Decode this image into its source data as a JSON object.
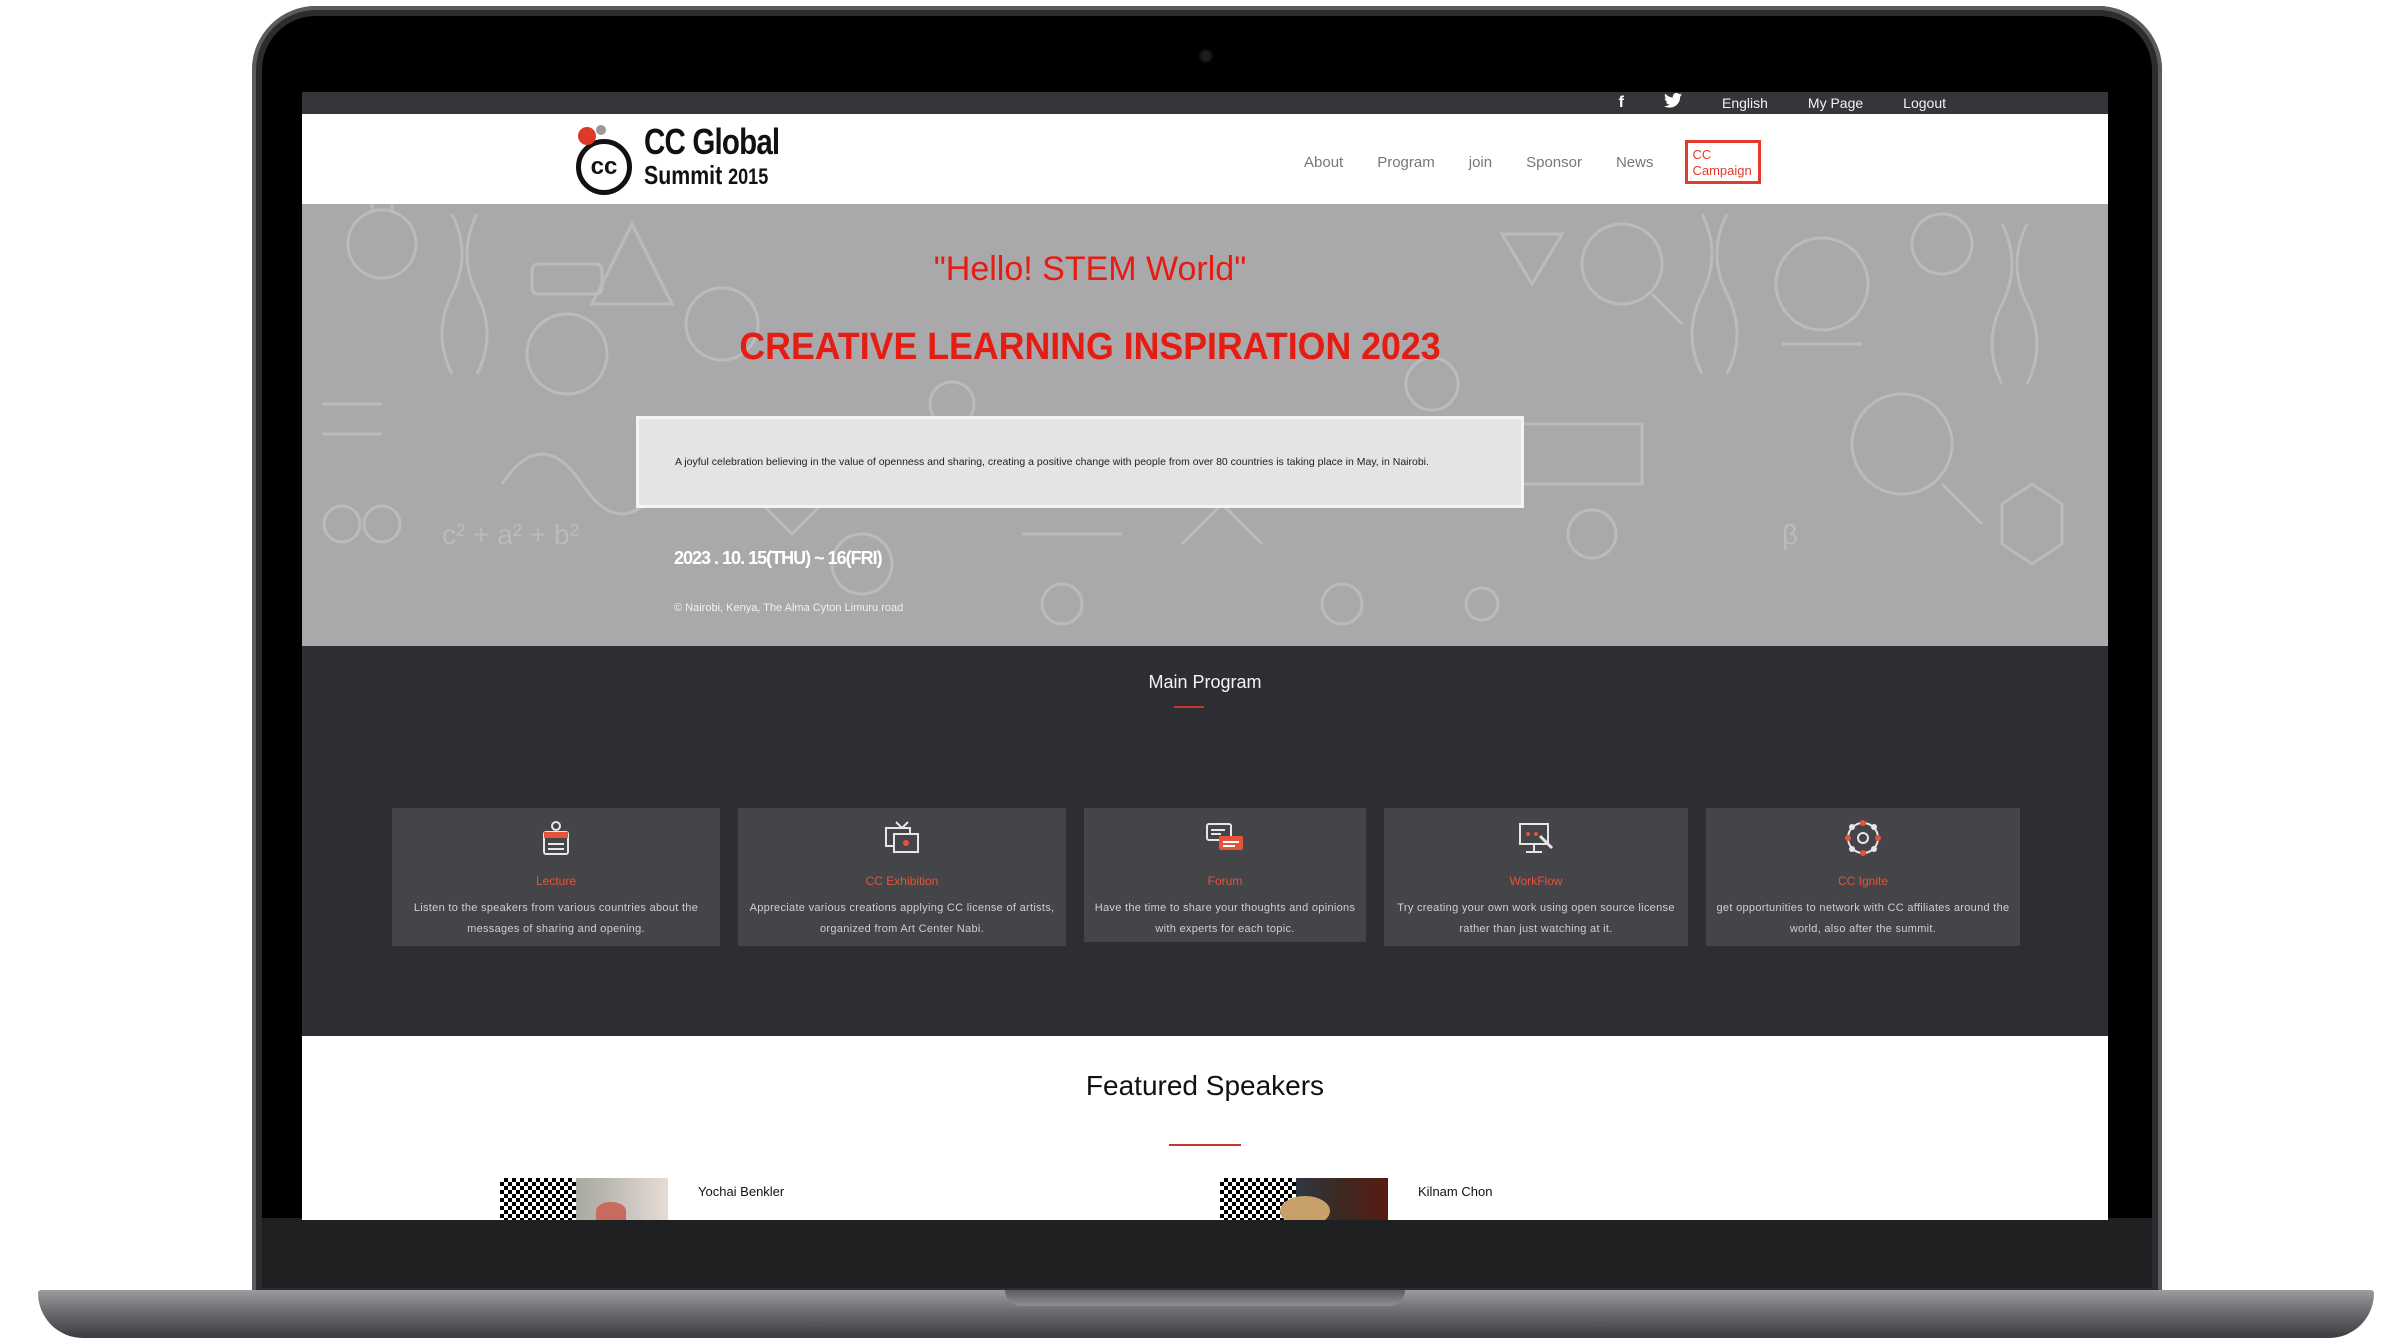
{
  "topbar": {
    "facebook_icon": "f",
    "twitter_icon": "twitter-bird",
    "language": "English",
    "my_page": "My Page",
    "logout": "Logout"
  },
  "logo": {
    "mark": "cc",
    "line1": "CC Global",
    "line2": "Summit",
    "year": "2015"
  },
  "nav": {
    "items": [
      "About",
      "Program",
      "join",
      "Sponsor",
      "News"
    ],
    "campaign": "CC Campaign"
  },
  "hero": {
    "quote": "\"Hello! STEM World\"",
    "headline": "CREATIVE LEARNING INSPIRATION 2023",
    "description": "A joyful celebration believing in the value of openness and sharing, creating a positive change with people from over 80 countries is taking place in May, in Nairobi.",
    "date": "2023 . 10. 15(THU) ~ 16(FRI)",
    "place": "© Nairobi, Kenya, The Alma Cyton Limuru road"
  },
  "program": {
    "title": "Main Program",
    "cards": [
      {
        "icon": "lecture-icon",
        "title": "Lecture",
        "desc": "Listen to the speakers from various countries about the messages of sharing and opening."
      },
      {
        "icon": "exhibition-icon",
        "title": "CC Exhibition",
        "desc": "Appreciate various creations applying CC license of artists, organized from Art Center Nabi."
      },
      {
        "icon": "forum-icon",
        "title": "Forum",
        "desc": "Have the time to share your thoughts and opinions with experts for each topic."
      },
      {
        "icon": "workflow-icon",
        "title": "WorkFlow",
        "desc": "Try creating your own work using open source license rather than just watching at it."
      },
      {
        "icon": "network-icon",
        "title": "CC Ignite",
        "desc": "get opportunities to network with CC affiliates around the world, also after the summit."
      }
    ]
  },
  "speakers": {
    "title": "Featured Speakers",
    "list": [
      {
        "name": "Yochai Benkler"
      },
      {
        "name": "Kilnam Chon"
      }
    ]
  },
  "colors": {
    "accent": "#e61b12",
    "program_bg": "#2c2e34",
    "card_bg": "#444549",
    "card_title": "#e8513a",
    "topbar_bg": "#35363a"
  }
}
